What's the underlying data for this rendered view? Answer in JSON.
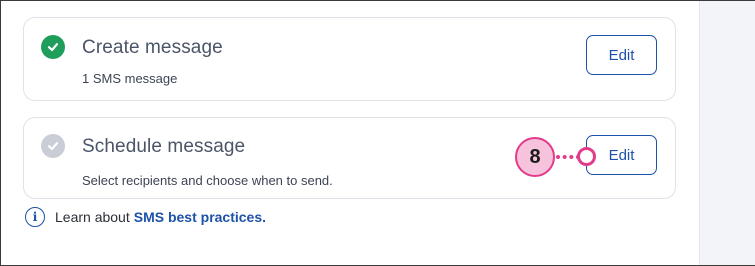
{
  "steps": [
    {
      "title": "Create message",
      "subtitle": "1 SMS message",
      "status": "complete",
      "status_color": "#1e9e5a",
      "status_icon": "check-circle-icon",
      "edit_label": "Edit"
    },
    {
      "title": "Schedule message",
      "subtitle": "Select recipients and choose when to send.",
      "status": "incomplete",
      "status_color": "#c9cdd6",
      "status_icon": "check-circle-icon",
      "edit_label": "Edit"
    }
  ],
  "info": {
    "icon": "info-icon",
    "prefix": "Learn about",
    "link_text": "SMS best practices."
  },
  "callout": {
    "number": "8",
    "color": "#e23b8a"
  },
  "colors": {
    "accent": "#1d52a8",
    "success": "#1e9e5a"
  }
}
